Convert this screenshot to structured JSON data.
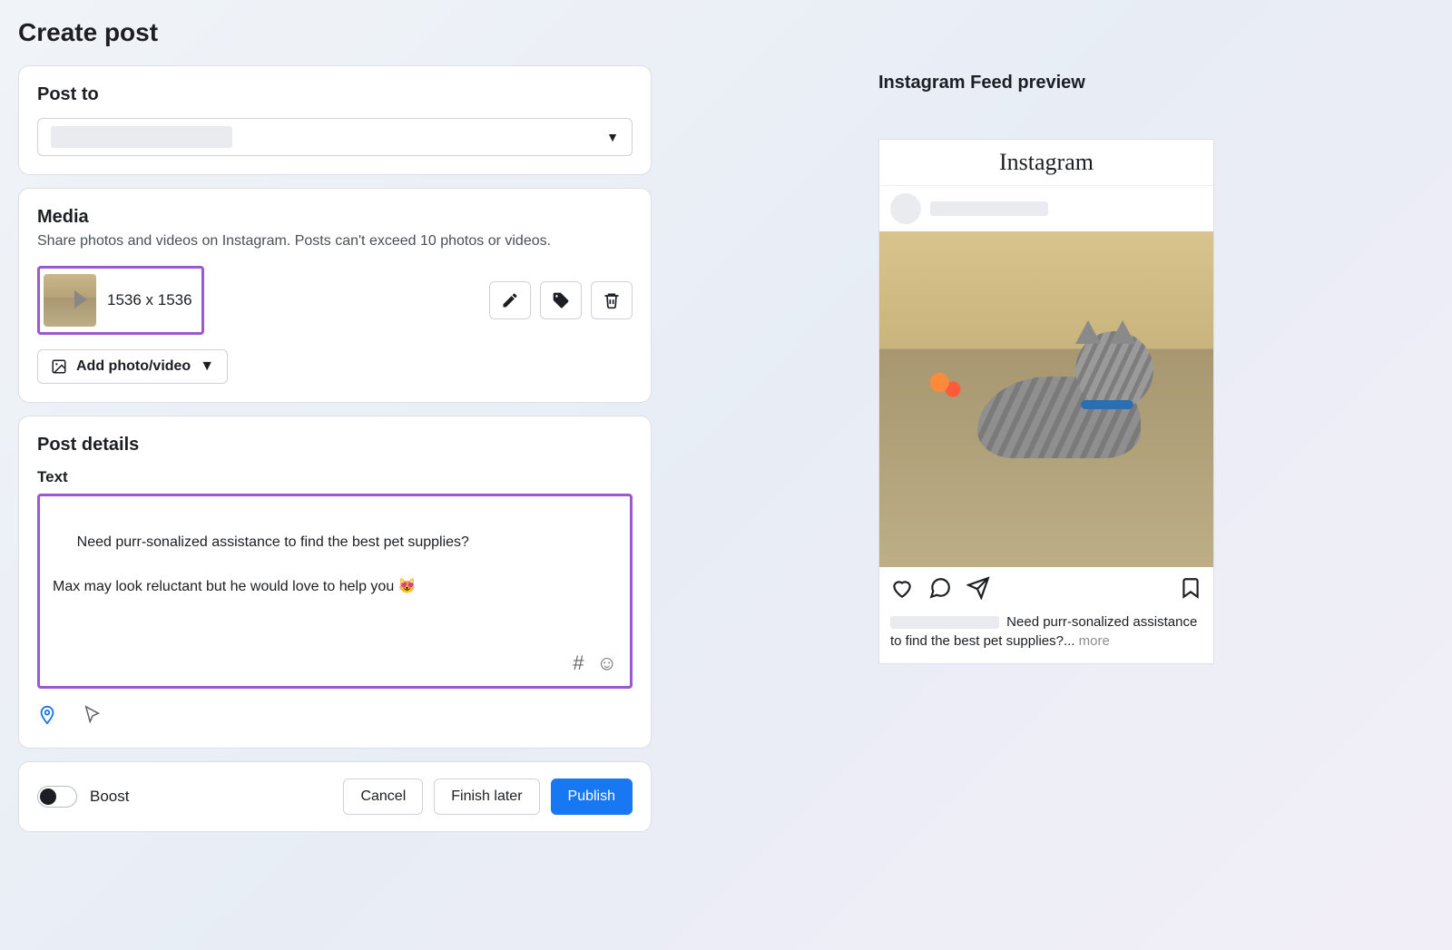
{
  "page_title": "Create post",
  "post_to": {
    "title": "Post to"
  },
  "media": {
    "title": "Media",
    "subtitle": "Share photos and videos on Instagram. Posts can't exceed 10 photos or videos.",
    "dimensions": "1536 x 1536",
    "add_label": "Add photo/video"
  },
  "post_details": {
    "title": "Post details",
    "text_label": "Text",
    "text_value": "Need purr-sonalized assistance to find the best pet supplies?\n\nMax may look reluctant but he would love to help you 😻"
  },
  "footer": {
    "boost_label": "Boost",
    "cancel": "Cancel",
    "finish_later": "Finish later",
    "publish": "Publish"
  },
  "preview": {
    "title": "Instagram Feed preview",
    "logo": "Instagram",
    "caption": "Need purr-sonalized assistance to find the best pet supplies?...",
    "more": " more"
  }
}
